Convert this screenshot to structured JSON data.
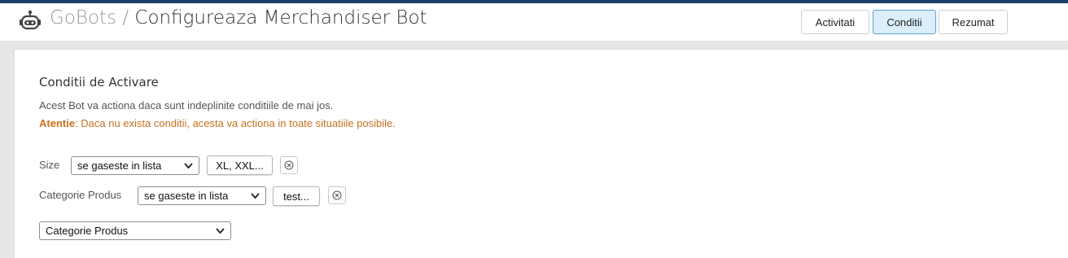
{
  "header": {
    "brand": "GoBots",
    "separator": " / ",
    "page_title": "Configureaza Merchandiser Bot",
    "robot_icon": "robot-icon",
    "tabs": [
      {
        "label": "Activitati",
        "active": false
      },
      {
        "label": "Conditii",
        "active": true
      },
      {
        "label": "Rezumat",
        "active": false
      }
    ]
  },
  "panel": {
    "heading": "Conditii de Activare",
    "description": "Acest Bot va actiona daca sunt indeplinite conditiile de mai jos.",
    "warning_label": "Atentie",
    "warning_text": ": Daca nu exista conditii, acesta va actiona in toate situatiile posibile."
  },
  "conditions": [
    {
      "field": "Size",
      "operator": "se gaseste in lista",
      "value": "XL, XXL..."
    },
    {
      "field": "Categorie Produs",
      "operator": "se gaseste in lista",
      "value": "test..."
    }
  ],
  "add_condition": {
    "selected": "Categorie Produs"
  },
  "colors": {
    "top_border": "#1b3f6e",
    "warning": "#c8711f",
    "active_tab_bg": "#dbeefb",
    "active_tab_border": "#5aa3d8"
  }
}
